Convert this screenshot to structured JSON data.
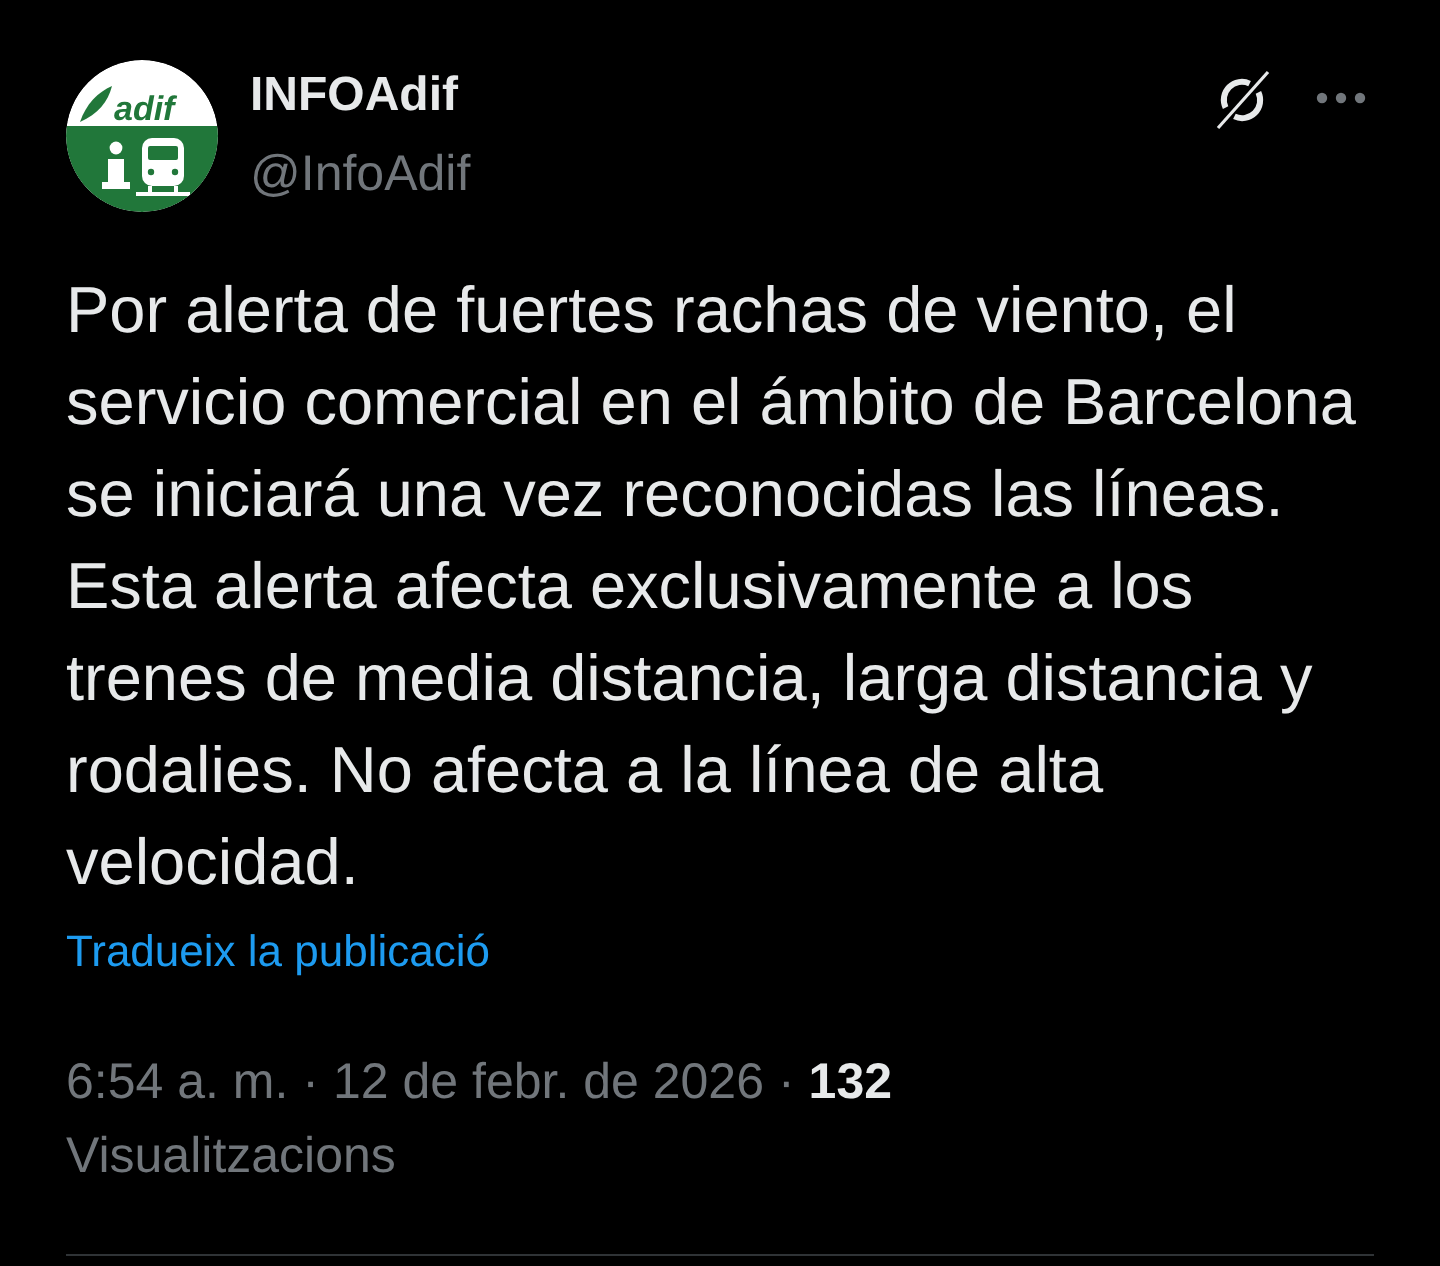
{
  "author": {
    "avatar": {
      "wordmark": "adif"
    },
    "name": "INFOAdif",
    "handle": "@InfoAdif"
  },
  "post": {
    "text": "Por alerta de fuertes rachas de viento, el servicio comercial en el ámbito de Barcelona se iniciará una vez reconocidas las líneas. Esta alerta afecta exclusivamente a los trenes de media distancia, larga distancia y rodalies. No afecta a la línea de alta velocidad.",
    "translate_link": "Tradueix la publicació"
  },
  "meta": {
    "items": [
      {
        "kind": "time",
        "text": "6:54 a. m."
      },
      {
        "kind": "separator",
        "text": "·"
      },
      {
        "kind": "date",
        "text": "12 de febr. de 2026"
      },
      {
        "kind": "separator",
        "text": "·"
      },
      {
        "kind": "count",
        "text": "132"
      }
    ],
    "views_label": "Visualitzacions"
  }
}
